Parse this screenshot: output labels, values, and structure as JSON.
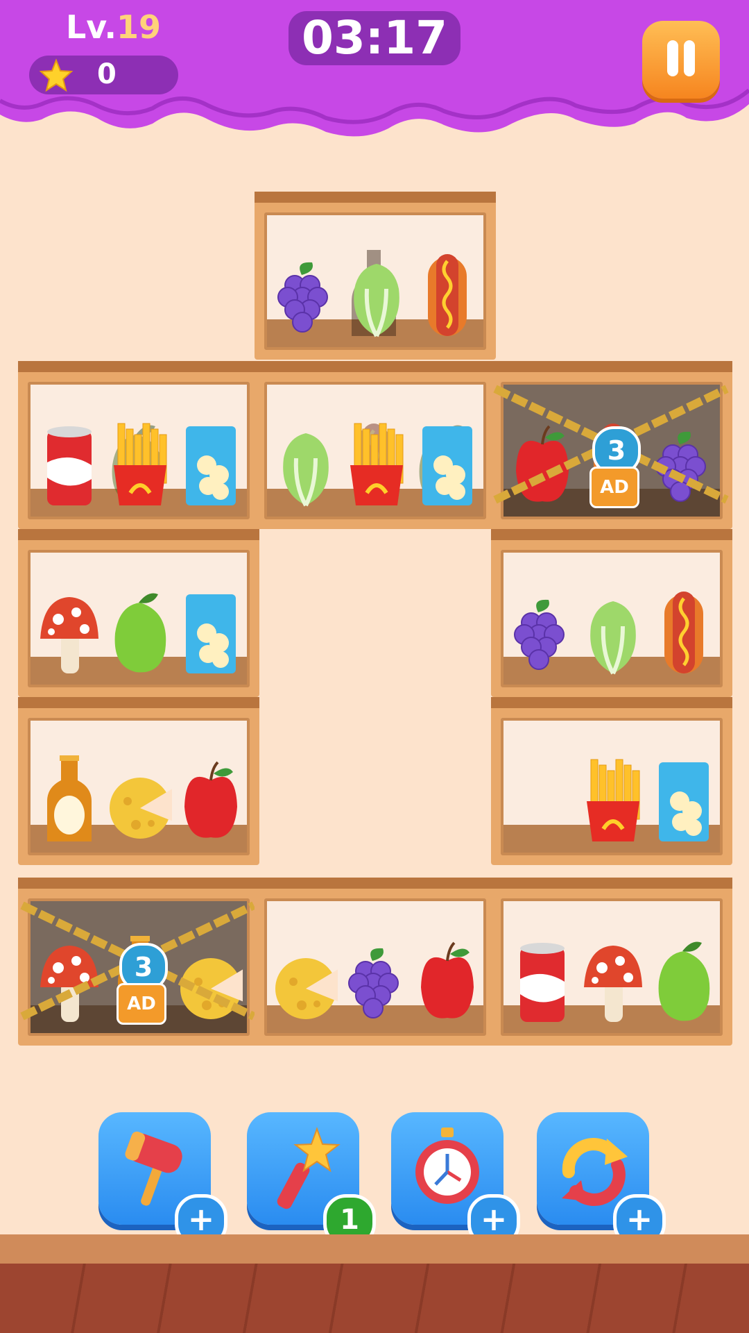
{
  "header": {
    "level_prefix": "Lv.",
    "level_number": "19",
    "stars": "0",
    "timer": "03:17"
  },
  "colors": {
    "header_purple": "#c748e6",
    "panel_purple": "#8d2fb4",
    "background": "#fde3cc",
    "shelf_wood": "#e8a86a",
    "booster_blue": "#3aa0f5",
    "pause_orange": "#f79a2e"
  },
  "shelves": [
    {
      "id": "top-center",
      "items": [
        "grapes",
        "lettuce",
        "hotdog"
      ],
      "back": [
        "bottle"
      ]
    },
    {
      "id": "r1-left",
      "items": [
        "soda-can",
        "fries",
        "chips"
      ],
      "back": [
        "mango",
        "can"
      ]
    },
    {
      "id": "r1-center",
      "items": [
        "lettuce",
        "fries",
        "chips"
      ],
      "back": [
        "hotdog",
        "mango"
      ]
    },
    {
      "id": "r1-right",
      "items": [
        "apple",
        "hotdog",
        "grapes"
      ],
      "locked": true,
      "lock_count": "3",
      "lock_label": "AD"
    },
    {
      "id": "r2-left",
      "items": [
        "mushroom",
        "mango",
        "chips"
      ]
    },
    {
      "id": "r2-right",
      "items": [
        "grapes",
        "lettuce",
        "hotdog"
      ]
    },
    {
      "id": "r3-left",
      "items": [
        "beer",
        "cheese",
        "apple"
      ]
    },
    {
      "id": "r3-right",
      "items": [
        "fries",
        "chips"
      ]
    },
    {
      "id": "r4-left",
      "items": [
        "mushroom",
        "beer",
        "cheese"
      ],
      "locked": true,
      "lock_count": "3",
      "lock_label": "AD"
    },
    {
      "id": "r4-center",
      "items": [
        "cheese",
        "grapes",
        "apple"
      ]
    },
    {
      "id": "r4-right",
      "items": [
        "soda-can",
        "mushroom",
        "mango"
      ]
    }
  ],
  "boosters": [
    {
      "name": "hammer",
      "badge": "+"
    },
    {
      "name": "magic-wand",
      "badge": "1"
    },
    {
      "name": "stopwatch",
      "badge": "+"
    },
    {
      "name": "shuffle",
      "badge": "+"
    }
  ]
}
